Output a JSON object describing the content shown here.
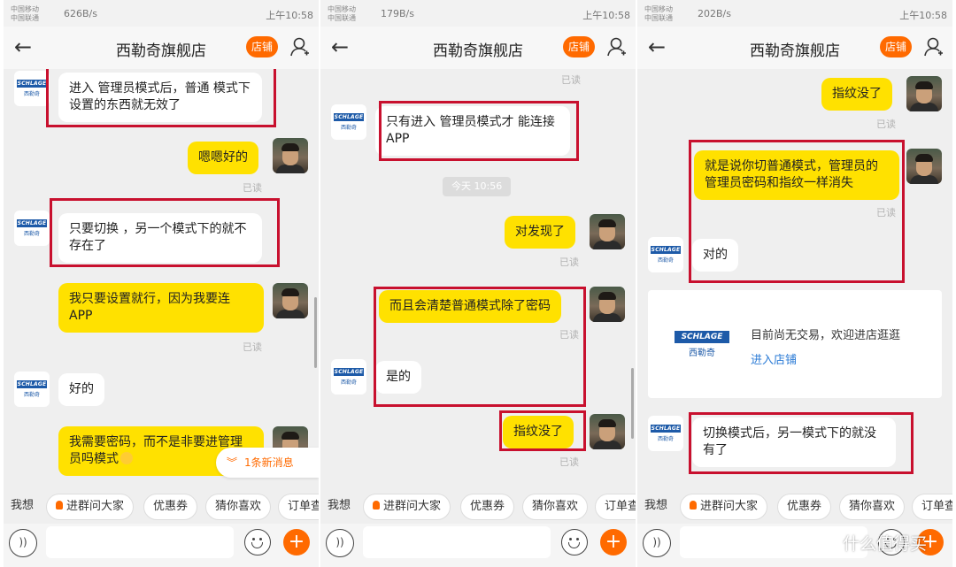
{
  "status": {
    "carrier1": "中国移动",
    "carrier2": "中国联通",
    "speeds": [
      "626B/s",
      "179B/s",
      "202B/s"
    ],
    "time": "上午10:58"
  },
  "header": {
    "title": "西勒奇旗舰店",
    "shop_button": "店铺"
  },
  "shop_avatar": {
    "logo_text": "SCHLAGE",
    "logo_cn": "西勒奇"
  },
  "panel1": {
    "m1": "进入 管理员模式后，普通 模式下设置的东西就无效了",
    "m2": "嗯嗯好的",
    "m2_read": "已读",
    "m3": "只要切换 ，另一个模式下的就不存在了",
    "m4": "我只要设置就行，因为我要连APP",
    "m4_read": "已读",
    "m5": "好的",
    "m6": "我需要密码，而不是非要进管理员吗模式",
    "new_messages": "1条新消息"
  },
  "panel2": {
    "top_read": "已读",
    "m1": "只有进入 管理员模式才 能连接APP",
    "time_divider": "今天  10:56",
    "m2": "对发现了",
    "m2_read": "已读",
    "m3": "而且会清楚普通模式除了密码",
    "m3_read": "已读",
    "m4": "是的",
    "m5": "指纹没了",
    "m5_read": "已读"
  },
  "panel3": {
    "m1": "指纹没了",
    "m1_read": "已读",
    "m2": "就是说你切普通模式，管理员的管理员密码和指纹一样消失",
    "m2_read": "已读",
    "m3": "对的",
    "card_logo": "SCHLAGE",
    "card_logo_cn": "西勒奇",
    "card_text": "目前尚无交易，欢迎进店逛逛",
    "card_link": "进入店铺",
    "m4": "切换模式后，另一模式下的就没有了"
  },
  "quickbar": {
    "label": "我想",
    "items": [
      "进群问大家",
      "优惠券",
      "猜你喜欢",
      "订单查"
    ]
  },
  "input": {
    "voice_icon": "voice-icon",
    "emoji_icon": "smile-icon",
    "plus_icon": "plus-icon"
  },
  "watermark": {
    "text": "什么值得买"
  },
  "colors": {
    "accent": "#ff6a00",
    "bubble_self": "#ffe100",
    "highlight_box": "#c8102e",
    "link": "#2b7bd6"
  }
}
